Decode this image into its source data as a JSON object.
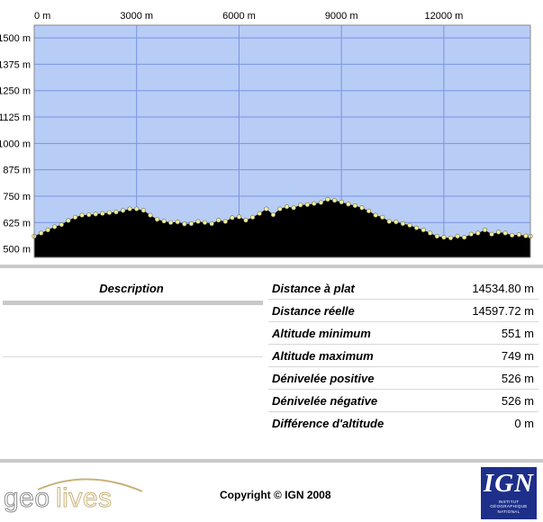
{
  "profile": {
    "x_ticks": [
      "0 m",
      "3000 m",
      "6000 m",
      "9000 m",
      "12000 m"
    ],
    "y_ticks": [
      "1500 m",
      "1375 m",
      "1250 m",
      "1125 m",
      "1000 m",
      "875 m",
      "750 m",
      "625 m",
      "500 m"
    ],
    "colors": {
      "plot_bg": "#b7cdf6",
      "grid": "#7a94e0",
      "terrain": "#000000",
      "track_point": "#f3eea0"
    }
  },
  "chart_data": {
    "type": "area",
    "x_unit": "m",
    "y_unit": "m",
    "xlim": [
      0,
      14535
    ],
    "ylim": [
      460,
      1560
    ],
    "x_ticks": [
      0,
      3000,
      6000,
      9000,
      12000
    ],
    "y_ticks": [
      500,
      625,
      750,
      875,
      1000,
      1125,
      1250,
      1375,
      1500
    ],
    "grid": true,
    "x": [
      0,
      200,
      400,
      600,
      800,
      1000,
      1200,
      1400,
      1600,
      1800,
      2000,
      2200,
      2400,
      2600,
      2800,
      3000,
      3200,
      3400,
      3600,
      3800,
      4000,
      4200,
      4400,
      4600,
      4800,
      5000,
      5200,
      5400,
      5600,
      5800,
      6000,
      6200,
      6400,
      6600,
      6800,
      7000,
      7200,
      7400,
      7600,
      7800,
      8000,
      8200,
      8400,
      8600,
      8800,
      9000,
      9200,
      9400,
      9600,
      9800,
      10000,
      10200,
      10400,
      10600,
      10800,
      11000,
      11200,
      11400,
      11600,
      11800,
      12000,
      12200,
      12400,
      12600,
      12800,
      13000,
      13200,
      13400,
      13600,
      13800,
      14000,
      14200,
      14400,
      14535
    ],
    "y": [
      560,
      575,
      590,
      605,
      615,
      635,
      650,
      660,
      662,
      665,
      668,
      672,
      675,
      682,
      690,
      690,
      683,
      660,
      640,
      632,
      625,
      628,
      618,
      620,
      630,
      625,
      620,
      636,
      630,
      648,
      652,
      636,
      650,
      668,
      690,
      662,
      690,
      700,
      695,
      708,
      710,
      715,
      720,
      735,
      730,
      722,
      712,
      705,
      695,
      680,
      660,
      650,
      630,
      628,
      620,
      612,
      600,
      590,
      575,
      560,
      555,
      552,
      560,
      555,
      570,
      575,
      590,
      570,
      580,
      575,
      565,
      568,
      562,
      560
    ]
  },
  "description": {
    "heading": "Description"
  },
  "stats": [
    {
      "label": "Distance à plat",
      "value": "14534.80 m"
    },
    {
      "label": "Distance réelle",
      "value": "14597.72 m"
    },
    {
      "label": "Altitude minimum",
      "value": "551 m"
    },
    {
      "label": "Altitude maximum",
      "value": "749 m"
    },
    {
      "label": "Dénivelée positive",
      "value": "526 m"
    },
    {
      "label": "Dénivelée négative",
      "value": "526 m"
    },
    {
      "label": "Différence d'altitude",
      "value": "0 m"
    }
  ],
  "footer": {
    "geolives_logo": "geolives",
    "copyright": "Copyright © IGN 2008",
    "ign_logo": "IGN",
    "ign_subtitle": [
      "INSTITUT",
      "GÉOGRAPHIQUE",
      "NATIONAL"
    ]
  }
}
